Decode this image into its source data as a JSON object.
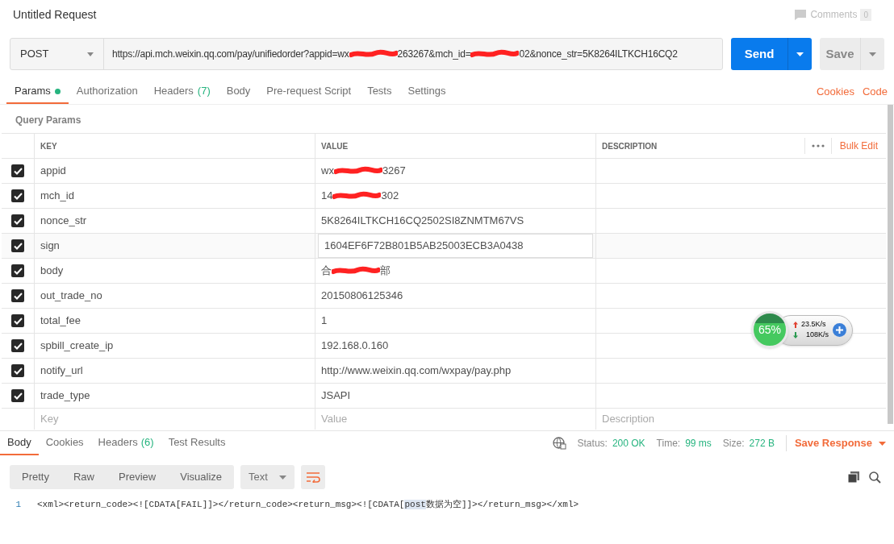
{
  "title": "Untitled Request",
  "comments": {
    "label": "Comments",
    "count": "0"
  },
  "request": {
    "method": "POST",
    "url": [
      {
        "kind": "text",
        "text": "https://api.mch.weixin.qq.com/pay/unifiedorder?appid=wx"
      },
      {
        "kind": "redacted"
      },
      {
        "kind": "text",
        "text": "263267&mch_id="
      },
      {
        "kind": "redacted"
      },
      {
        "kind": "text",
        "text": "02&nonce_str=5K8264ILTKCH16CQ2"
      }
    ],
    "send": "Send",
    "save": "Save"
  },
  "tabs": [
    {
      "label": "Params",
      "selected": true,
      "dot": true
    },
    {
      "label": "Authorization",
      "selected": false
    },
    {
      "label": "Headers",
      "count": "(7)",
      "selected": false
    },
    {
      "label": "Body",
      "selected": false
    },
    {
      "label": "Pre-request Script",
      "selected": false
    },
    {
      "label": "Tests",
      "selected": false
    },
    {
      "label": "Settings",
      "selected": false
    }
  ],
  "tab_links": [
    "Cookies",
    "Code"
  ],
  "section_title": "Query Params",
  "table": {
    "columns": [
      "KEY",
      "VALUE",
      "DESCRIPTION"
    ],
    "bulk_edit": "Bulk Edit",
    "rows": [
      {
        "key": "appid",
        "checked": true,
        "value": [
          {
            "kind": "text",
            "text": "wx"
          },
          {
            "kind": "redacted"
          },
          {
            "kind": "text",
            "text": "3267"
          }
        ]
      },
      {
        "key": "mch_id",
        "checked": true,
        "value": [
          {
            "kind": "text",
            "text": "14"
          },
          {
            "kind": "redacted"
          },
          {
            "kind": "text",
            "text": "302"
          }
        ]
      },
      {
        "key": "nonce_str",
        "checked": true,
        "value": [
          {
            "kind": "text",
            "text": "5K8264ILTKCH16CQ2502SI8ZNMTM67VS"
          }
        ]
      },
      {
        "key": "sign",
        "checked": true,
        "editing": true,
        "value": [
          {
            "kind": "text",
            "text": "1604EF6F72B801B5AB25003ECB3A0438"
          }
        ]
      },
      {
        "key": "body",
        "checked": true,
        "value": [
          {
            "kind": "text",
            "text": "合"
          },
          {
            "kind": "redacted"
          },
          {
            "kind": "text",
            "text": "部"
          }
        ]
      },
      {
        "key": "out_trade_no",
        "checked": true,
        "value": [
          {
            "kind": "text",
            "text": "20150806125346"
          }
        ]
      },
      {
        "key": "total_fee",
        "checked": true,
        "value": [
          {
            "kind": "text",
            "text": "1"
          }
        ]
      },
      {
        "key": "spbill_create_ip",
        "checked": true,
        "value": [
          {
            "kind": "text",
            "text": "192.168.0.160"
          }
        ]
      },
      {
        "key": "notify_url",
        "checked": true,
        "value": [
          {
            "kind": "text",
            "text": "http://www.weixin.qq.com/wxpay/pay.php"
          }
        ]
      },
      {
        "key": "trade_type",
        "checked": true,
        "value": [
          {
            "kind": "text",
            "text": "JSAPI"
          }
        ]
      }
    ],
    "new_row": [
      {
        "placeholder": "Key"
      },
      {
        "placeholder": "Value"
      },
      {
        "placeholder": "Description"
      }
    ]
  },
  "response": {
    "tabs": [
      {
        "label": "Body",
        "selected": true
      },
      {
        "label": "Cookies",
        "selected": false
      },
      {
        "label": "Headers",
        "count": "(6)",
        "selected": false
      },
      {
        "label": "Test Results",
        "selected": false
      }
    ],
    "status_label": "Status:",
    "status": "200 OK",
    "time_label": "Time:",
    "time": "99 ms",
    "size_label": "Size:",
    "size": "272 B",
    "save": "Save Response",
    "views": [
      {
        "label": "Pretty",
        "selected": false
      },
      {
        "label": "Raw",
        "selected": false
      },
      {
        "label": "Preview",
        "selected": false
      },
      {
        "label": "Visualize",
        "selected": false
      }
    ],
    "format": "Text",
    "lines": [
      {
        "number": "1",
        "before": "<xml><return_code><![CDATA[FAIL]]></return_code><return_msg><![CDATA[",
        "highlight": "post",
        "after": "数据为空]]></return_msg></xml>"
      }
    ]
  },
  "net_meter": {
    "percent": "65%",
    "up": "23.5K/s",
    "down": "108K/s"
  }
}
